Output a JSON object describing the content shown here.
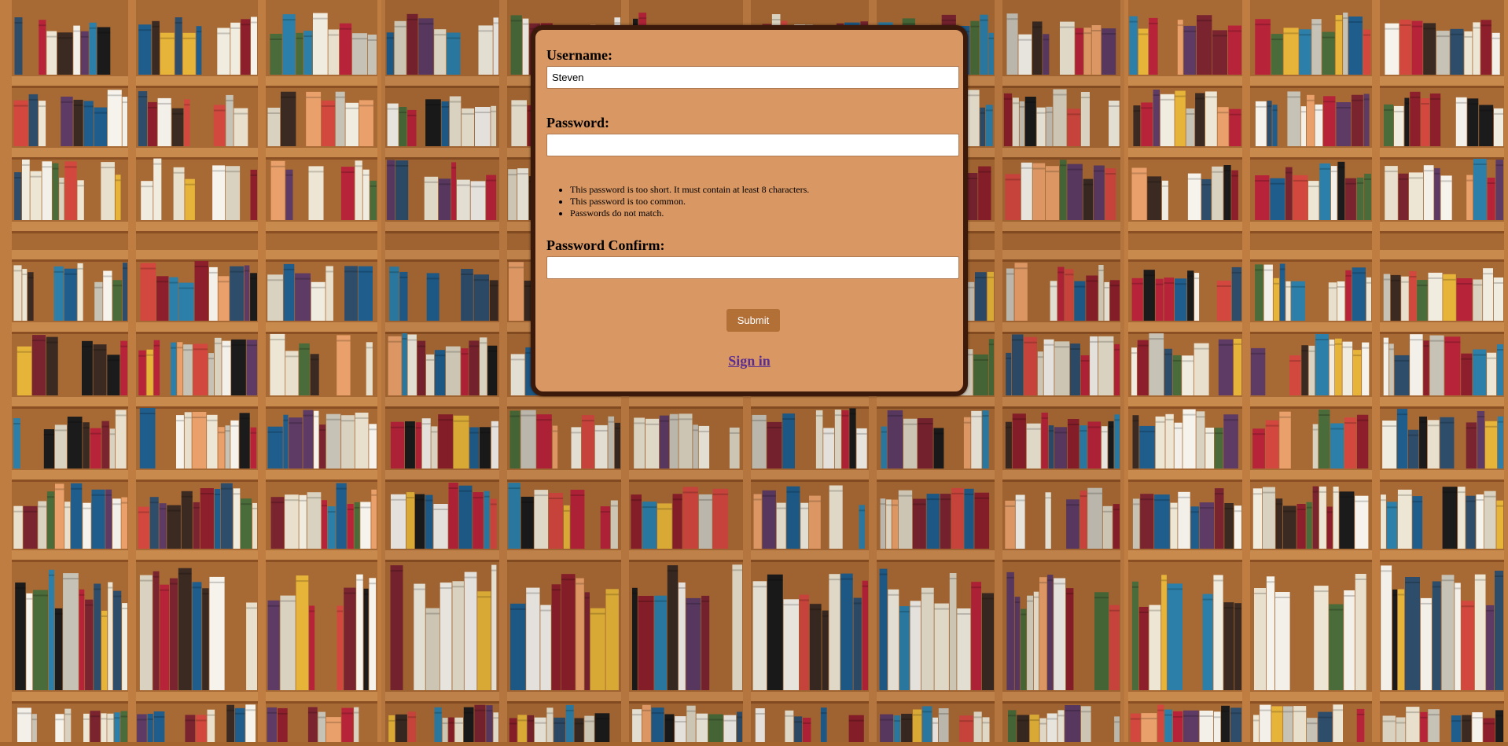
{
  "form": {
    "username_label": "Username:",
    "username_value": "Steven",
    "password_label": "Password:",
    "password_value": "",
    "password_errors": [
      "This password is too short. It must contain at least 8 characters.",
      "This password is too common.",
      "Passwords do not match."
    ],
    "password_confirm_label": "Password Confirm:",
    "password_confirm_value": "",
    "submit_label": "Submit",
    "signin_link": "Sign in"
  },
  "colors": {
    "card_background": "#d99763",
    "card_border": "#3b1a0c",
    "submit_button": "#b26f36",
    "link": "#5a2d91",
    "shelf_wood": "#c98a4e"
  }
}
